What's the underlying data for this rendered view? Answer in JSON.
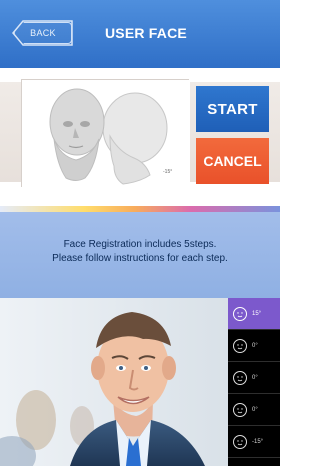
{
  "header": {
    "back_label": "BACK",
    "title": "USER FACE"
  },
  "actions": {
    "start_label": "START",
    "cancel_label": "CANCEL"
  },
  "preview": {
    "angle_label": "-15°"
  },
  "instructions": {
    "line1": "Face Registration includes 5steps.",
    "line2": "Please follow instructions for each step."
  },
  "steps": [
    {
      "angle": "15°",
      "active": true
    },
    {
      "angle": "0°",
      "active": false
    },
    {
      "angle": "0°",
      "active": false
    },
    {
      "angle": "0°",
      "active": false
    },
    {
      "angle": "-15°",
      "active": false
    }
  ],
  "colors": {
    "header_blue": "#2f6fc7",
    "start_blue": "#1f5fb7",
    "cancel_orange": "#e9512a",
    "step_active": "#7c59cc"
  }
}
